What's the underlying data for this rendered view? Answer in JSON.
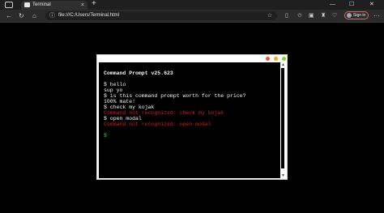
{
  "browser": {
    "tab_title": "Terminal",
    "tab_close": "×",
    "new_tab": "+",
    "win_minimize": "—",
    "win_maximize": "☐",
    "win_close": "✕",
    "address": "file:///C:/Users/Terminal.html",
    "signin_label": "Sign in",
    "more": "···"
  },
  "terminal": {
    "title": "Command Prompt v25.623",
    "lines": [
      "$ hello",
      "sup yo",
      "$ is this command prompt worth for the price?",
      "100% mate!",
      "$ check my kojak"
    ],
    "errors": [
      "Command not recognized: check my kojak",
      "$ open modal",
      "Command not recognized: open modal"
    ],
    "prompt": "$",
    "dot_colors": [
      "#e9573f",
      "#f5a623",
      "#7ed321"
    ]
  }
}
